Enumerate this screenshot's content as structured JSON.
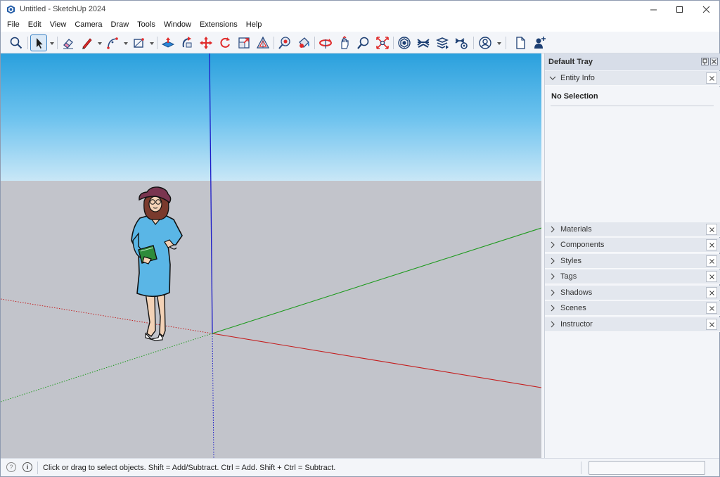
{
  "window": {
    "title": "Untitled - SketchUp 2024"
  },
  "menu": [
    "File",
    "Edit",
    "View",
    "Camera",
    "Draw",
    "Tools",
    "Window",
    "Extensions",
    "Help"
  ],
  "toolbar": {
    "tools": [
      "search-icon",
      "select-icon",
      "eraser-icon",
      "line-icon",
      "arc-icon",
      "rectangle-icon",
      "push-pull-icon",
      "follow-me-icon",
      "move-icon",
      "rotate-icon",
      "scale-icon",
      "offset-icon",
      "tape-measure-icon",
      "paint-bucket-icon",
      "orbit-icon",
      "pan-icon",
      "zoom-icon",
      "zoom-extents-icon",
      "3d-warehouse-icon",
      "extension-warehouse-icon",
      "layout-icon",
      "extension-manager-icon",
      "profile-icon",
      "new-document-icon",
      "add-user-icon"
    ],
    "active_tool": "select-icon"
  },
  "tray": {
    "title": "Default Tray",
    "entity_info": {
      "label": "Entity Info",
      "selection": "No Selection"
    },
    "panels": [
      "Materials",
      "Components",
      "Styles",
      "Tags",
      "Shadows",
      "Scenes",
      "Instructor"
    ]
  },
  "status": {
    "message": "Click or drag to select objects. Shift = Add/Subtract. Ctrl = Add. Shift + Ctrl = Subtract."
  },
  "colors": {
    "accent": "#3b82c4",
    "red_axis": "#c41e1e",
    "green_axis": "#1e9a1e",
    "blue_axis": "#1a1ac8"
  }
}
